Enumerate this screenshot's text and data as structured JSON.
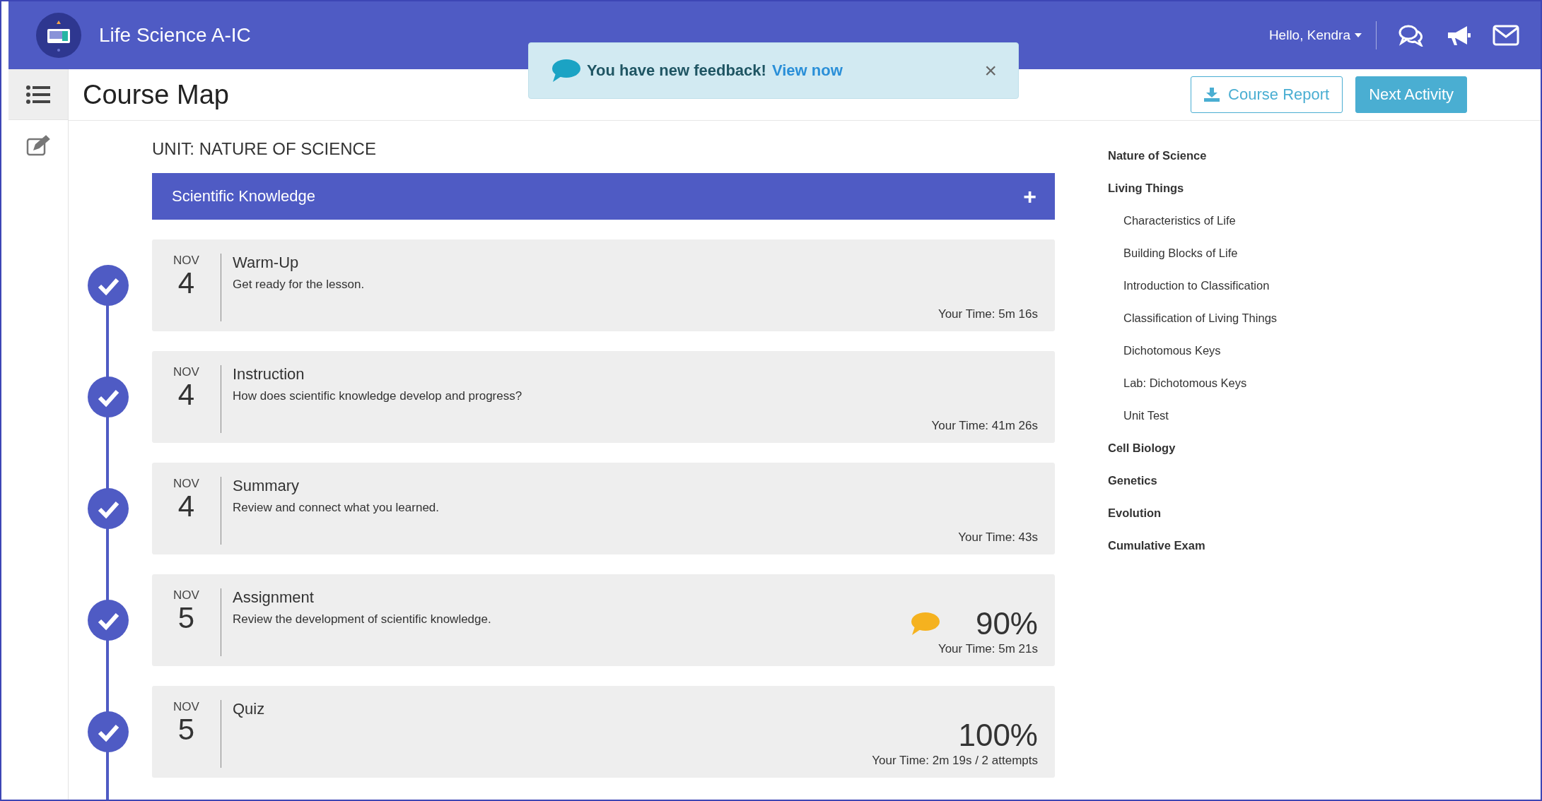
{
  "header": {
    "course_title": "Life Science A-IC",
    "greeting": "Hello, Kendra"
  },
  "toast": {
    "message": "You have new feedback!",
    "link": "View now",
    "close": "×"
  },
  "page": {
    "title": "Course Map",
    "buttons": [
      {
        "kind": "outline",
        "label": "Course Report"
      },
      {
        "kind": "primary",
        "label": "Next Activity"
      }
    ]
  },
  "unit": {
    "title": "UNIT: NATURE OF SCIENCE",
    "section": "Scientific Knowledge",
    "section_toggle": "+"
  },
  "activities": [
    {
      "month": "NOV",
      "day": "4",
      "title": "Warm-Up",
      "description": "Get ready for the lesson.",
      "time": "Your Time: 5m 16s",
      "completed": true,
      "feedback": false
    },
    {
      "month": "NOV",
      "day": "4",
      "title": "Instruction",
      "description": "How does scientific knowledge develop and progress?",
      "time": "Your Time: 41m 26s",
      "completed": true,
      "feedback": false
    },
    {
      "month": "NOV",
      "day": "4",
      "title": "Summary",
      "description": "Review and connect what you learned.",
      "time": "Your Time: 43s",
      "completed": true,
      "feedback": false
    },
    {
      "month": "NOV",
      "day": "5",
      "title": "Assignment",
      "description": "Review the development of scientific knowledge.",
      "score": "90%",
      "time": "Your Time: 5m 21s",
      "completed": true,
      "feedback": true
    },
    {
      "month": "NOV",
      "day": "5",
      "title": "Quiz",
      "score": "100%",
      "time": "Your Time: 2m 19s / 2 attempts",
      "completed": true,
      "feedback": false
    }
  ],
  "outline": [
    {
      "label": "Nature of Science"
    },
    {
      "label": "Living Things",
      "children": [
        {
          "label": "Characteristics of Life"
        },
        {
          "label": "Building Blocks of Life"
        },
        {
          "label": "Introduction to Classification"
        },
        {
          "label": "Classification of Living Things"
        },
        {
          "label": "Dichotomous Keys"
        },
        {
          "label": "Lab: Dichotomous Keys"
        },
        {
          "label": "Unit Test"
        }
      ]
    },
    {
      "label": "Cell Biology"
    },
    {
      "label": "Genetics"
    },
    {
      "label": "Evolution"
    },
    {
      "label": "Cumulative Exam"
    }
  ]
}
